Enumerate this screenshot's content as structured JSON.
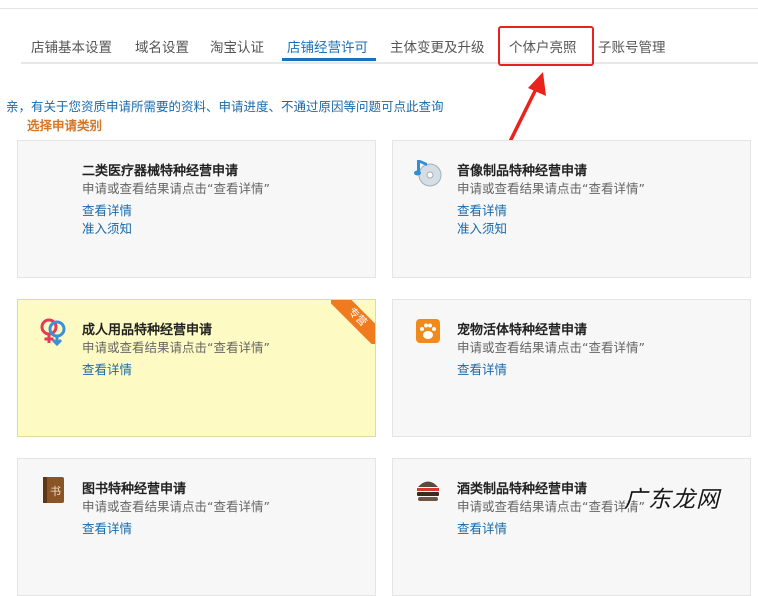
{
  "tabs": [
    {
      "label": "店铺基本设置"
    },
    {
      "label": "域名设置"
    },
    {
      "label": "淘宝认证"
    },
    {
      "label": "店铺经营许可"
    },
    {
      "label": "主体变更及升级"
    },
    {
      "label": "个体户亮照"
    },
    {
      "label": "子账号管理"
    }
  ],
  "active_tab": "店铺经营许可",
  "notice": "亲，有关于您资质申请所需要的资料、申请进度、不通过原因等问题可点此查询",
  "section_title": "选择申请类别",
  "cards": [
    {
      "title": "二类医疗器械特种经营申请",
      "desc": "申请或查看结果请点击“查看详情”",
      "link1": "查看详情",
      "link2": "准入须知"
    },
    {
      "title": "音像制品特种经营申请",
      "desc": "申请或查看结果请点击“查看详情”",
      "link1": "查看详情",
      "link2": "准入须知",
      "icon": "music-disc-icon"
    },
    {
      "title": "成人用品特种经营申请",
      "desc": "申请或查看结果请点击“查看详情”",
      "link1": "查看详情",
      "badge": "专营",
      "icon": "gender-symbol-icon"
    },
    {
      "title": "宠物活体特种经营申请",
      "desc": "申请或查看结果请点击“查看详情”",
      "link1": "查看详情",
      "icon": "paw-icon"
    },
    {
      "title": "图书特种经营申请",
      "desc": "申请或查看结果请点击“查看详情”",
      "link1": "查看详情",
      "icon": "book-icon"
    },
    {
      "title": "酒类制品特种经营申请",
      "desc": "申请或查看结果请点击“查看详情”",
      "link1": "查看详情",
      "icon": "burger-icon"
    }
  ],
  "watermark": "广东龙网",
  "colors": {
    "accent": "#1d6fb8",
    "link": "#1a6aaa",
    "callout": "#e8231e",
    "section_title": "#d3782b",
    "badge": "#f07b1f"
  }
}
